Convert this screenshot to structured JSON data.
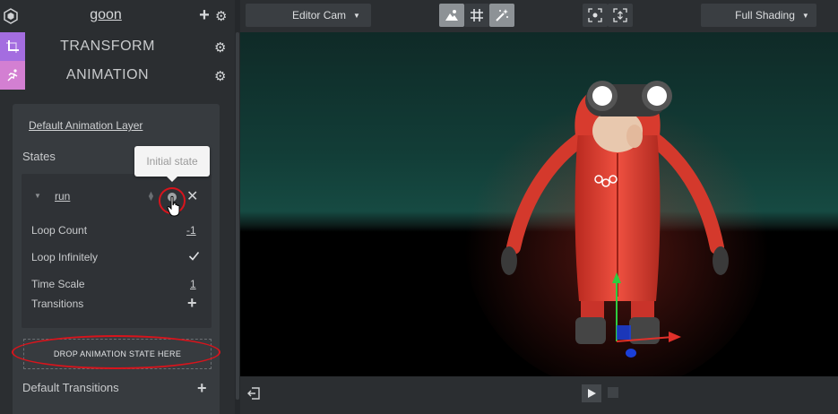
{
  "entity": {
    "name": "goon"
  },
  "components": [
    {
      "title": "TRANSFORM",
      "badge_color": "#a46de0",
      "icon": "transform-icon"
    },
    {
      "title": "ANIMATION",
      "badge_color": "#d37fd2",
      "icon": "animation-run-icon"
    }
  ],
  "animation": {
    "layer_name": "Default Animation Layer",
    "states_label": "States",
    "state": {
      "name": "run",
      "loop_count_label": "Loop Count",
      "loop_count_value": "-1",
      "loop_infinitely_label": "Loop Infinitely",
      "loop_infinitely_checked": true,
      "time_scale_label": "Time Scale",
      "time_scale_value": "1",
      "transitions_label": "Transitions"
    },
    "drop_zone_label": "DROP ANIMATION STATE HERE",
    "default_transitions_label": "Default Transitions",
    "tooltip": "Initial state"
  },
  "toolbar": {
    "camera_select": "Editor Cam",
    "shading_select": "Full Shading",
    "tools": [
      "terrain-icon",
      "grid-icon",
      "magic-wand-icon"
    ],
    "view_buttons": [
      "frame-selection-icon",
      "frame-all-icon"
    ]
  },
  "colors": {
    "highlight": "#d8141c",
    "character": "#e8473a",
    "tooltip_bg": "#f4f4f4"
  }
}
